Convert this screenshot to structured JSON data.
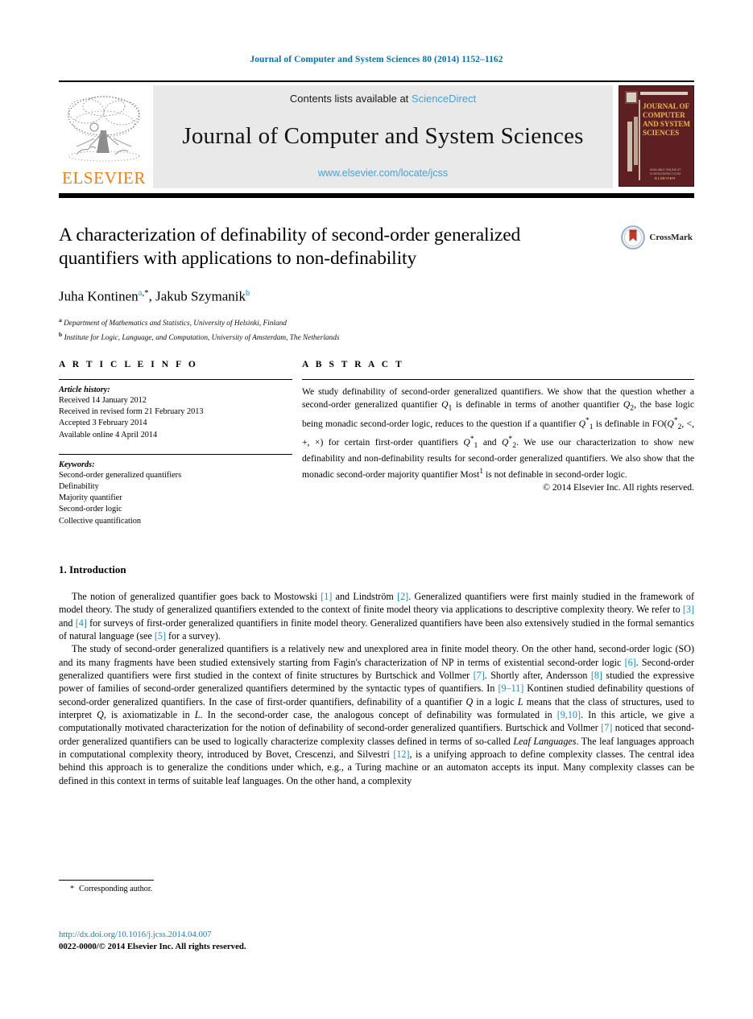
{
  "running_head": "Journal of Computer and System Sciences 80 (2014) 1152–1162",
  "masthead": {
    "contents_prefix": "Contents lists available at ",
    "sciencedirect": "ScienceDirect",
    "journal_name": "Journal of Computer and System Sciences",
    "journal_url": "www.elsevier.com/locate/jcss",
    "publisher": "ELSEVIER",
    "cover": {
      "line1": "JOURNAL OF",
      "line2": "COMPUTER",
      "line3": "AND SYSTEM",
      "line4": "SCIENCES",
      "footer_small": "AVAILABLE ONLINE AT SCIENCEDIRECT.COM",
      "footer_brand": "ELSEVIER"
    }
  },
  "article": {
    "title": "A characterization of definability of second-order generalized quantifiers with applications to non-definability",
    "crossmark_label": "CrossMark",
    "authors": [
      {
        "name": "Juha Kontinen",
        "marks": "a,*"
      },
      {
        "name": "Jakub Szymanik",
        "marks": "b"
      }
    ],
    "authors_line": "Juha Kontinen",
    "author_two": ", Jakub Szymanik",
    "affiliations": [
      {
        "mark": "a",
        "text": "Department of Mathematics and Statistics, University of Helsinki, Finland"
      },
      {
        "mark": "b",
        "text": "Institute for Logic, Language, and Computation, University of Amsterdam, The Netherlands"
      }
    ]
  },
  "article_info": {
    "heading": "A R T I C L E    I N F O",
    "history_label": "Article history:",
    "history": [
      "Received 14 January 2012",
      "Received in revised form 21 February 2013",
      "Accepted 3 February 2014",
      "Available online 4 April 2014"
    ],
    "keywords_label": "Keywords:",
    "keywords": [
      "Second-order generalized quantifiers",
      "Definability",
      "Majority quantifier",
      "Second-order logic",
      "Collective quantification"
    ]
  },
  "abstract": {
    "heading": "A B S T R A C T",
    "part1": "We study definability of second-order generalized quantifiers. We show that the question whether a second-order generalized quantifier ",
    "q1": "Q",
    "q1_sub": "1",
    "part2": " is definable in terms of another quantifier ",
    "q2": "Q",
    "q2_sub": "2",
    "part3": ", the base logic being monadic second-order logic, reduces to the question if a quantifier ",
    "q3": "Q",
    "q3_sub": "1",
    "q3_sup": "*",
    "part4": " is definable in FO(",
    "q4": "Q",
    "q4_sub": "2",
    "q4_sup": "*",
    "part5": ", <, +, ×) for certain first-order quantifiers ",
    "q5": "Q",
    "q5_sub": "1",
    "q5_sup": "*",
    "part6": " and ",
    "q6": "Q",
    "q6_sub": "2",
    "q6_sup": "*",
    "part7": ". We use our characterization to show new definability and non-definability results for second-order generalized quantifiers. We also show that the monadic second-order majority quantifier Most",
    "most_sup": "1",
    "part8": " is not definable in second-order logic.",
    "copyright": "© 2014 Elsevier Inc. All rights reserved."
  },
  "intro": {
    "section_title": "1. Introduction",
    "paragraphs": [
      {
        "segments": [
          {
            "t": "The notion of generalized quantifier goes back to Mostowski "
          },
          {
            "t": "[1]",
            "k": "ref"
          },
          {
            "t": " and Lindström "
          },
          {
            "t": "[2]",
            "k": "ref"
          },
          {
            "t": ". Generalized quantifiers were first mainly studied in the framework of model theory. The study of generalized quantifiers extended to the context of finite model theory via applications to descriptive complexity theory. We refer to "
          },
          {
            "t": "[3]",
            "k": "ref"
          },
          {
            "t": " and "
          },
          {
            "t": "[4]",
            "k": "ref"
          },
          {
            "t": " for surveys of first-order generalized quantifiers in finite model theory. Generalized quantifiers have been also extensively studied in the formal semantics of natural language (see "
          },
          {
            "t": "[5]",
            "k": "ref"
          },
          {
            "t": " for a survey)."
          }
        ]
      },
      {
        "segments": [
          {
            "t": "The study of second-order generalized quantifiers is a relatively new and unexplored area in finite model theory. On the other hand, second-order logic (SO) and its many fragments have been studied extensively starting from Fagin's characterization of NP in terms of existential second-order logic "
          },
          {
            "t": "[6]",
            "k": "ref"
          },
          {
            "t": ". Second-order generalized quantifiers were first studied in the context of finite structures by Burtschick and Vollmer "
          },
          {
            "t": "[7]",
            "k": "ref"
          },
          {
            "t": ". Shortly after, Andersson "
          },
          {
            "t": "[8]",
            "k": "ref"
          },
          {
            "t": " studied the expressive power of families of second-order generalized quantifiers determined by the syntactic types of quantifiers. In "
          },
          {
            "t": "[9–11]",
            "k": "ref"
          },
          {
            "t": " Kontinen studied definability questions of second-order generalized quantifiers. In the case of first-order quantifiers, definability of a quantifier "
          },
          {
            "t": "Q",
            "k": "it"
          },
          {
            "t": " in a logic "
          },
          {
            "t": "L",
            "k": "it"
          },
          {
            "t": " means that the class of structures, used to interpret "
          },
          {
            "t": "Q",
            "k": "it"
          },
          {
            "t": ", is axiomatizable in "
          },
          {
            "t": "L",
            "k": "it"
          },
          {
            "t": ". In the second-order case, the analogous concept of definability was formulated in "
          },
          {
            "t": "[9,10]",
            "k": "ref"
          },
          {
            "t": ". In this article, we give a computationally motivated characterization for the notion of definability of second-order generalized quantifiers. Burtschick and Vollmer "
          },
          {
            "t": "[7]",
            "k": "ref"
          },
          {
            "t": " noticed that second-order generalized quantifiers can be used to logically characterize complexity classes defined in terms of so-called "
          },
          {
            "t": "Leaf Languages",
            "k": "it"
          },
          {
            "t": ". The leaf languages approach in computational complexity theory, introduced by Bovet, Crescenzi, and Silvestri "
          },
          {
            "t": "[12]",
            "k": "ref"
          },
          {
            "t": ", is a unifying approach to define complexity classes. The central idea behind this approach is to generalize the conditions under which, e.g., a Turing machine or an automaton accepts its input. Many complexity classes can be defined in this context in terms of suitable leaf languages. On the other hand, a complexity"
          }
        ]
      }
    ]
  },
  "footer": {
    "corresponding_star": "*",
    "corresponding_author": "Corresponding author.",
    "doi": "http://dx.doi.org/10.1016/j.jcss.2014.04.007",
    "issn_line": "0022-0000/© 2014 Elsevier Inc. All rights reserved."
  },
  "colors": {
    "link": "#1a8fbf",
    "running_head": "#0b72a8",
    "sciencedirect": "#4a9fd4",
    "elsevier_orange": "#f07f13",
    "cover_maroon": "#5d1f22",
    "cover_gold": "#e8b64d"
  }
}
